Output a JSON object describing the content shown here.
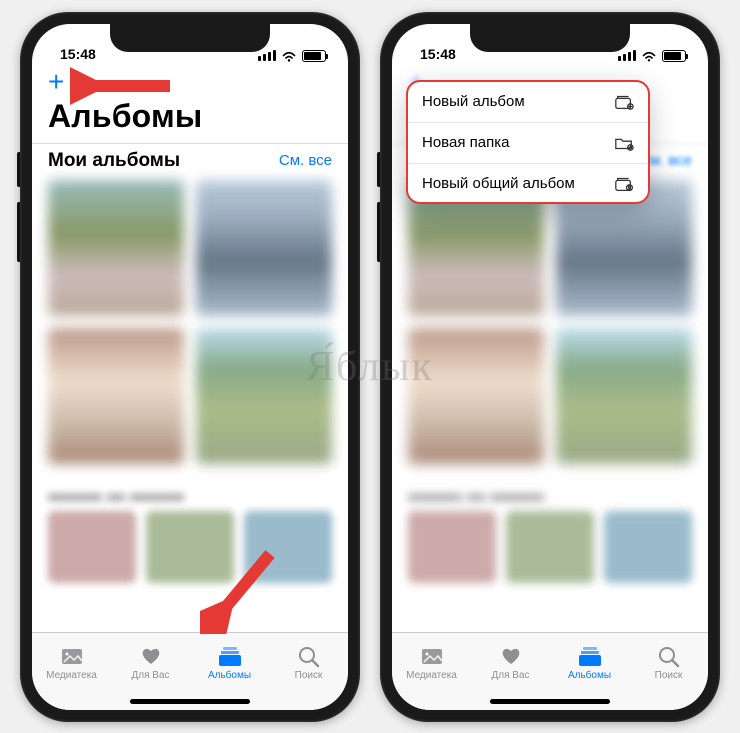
{
  "status": {
    "time": "15:48"
  },
  "nav": {
    "plus": "+",
    "title": "Альбомы"
  },
  "section": {
    "my_albums": "Мои альбомы",
    "see_all": "См. все"
  },
  "tabs": {
    "library": "Медиатека",
    "for_you": "Для Вас",
    "albums": "Альбомы",
    "search": "Поиск"
  },
  "menu": {
    "new_album": "Новый альбом",
    "new_folder": "Новая папка",
    "new_shared": "Новый общий альбом"
  },
  "watermark": "Я́блык"
}
